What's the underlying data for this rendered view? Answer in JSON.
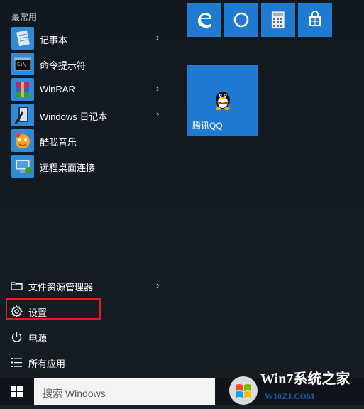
{
  "start_menu": {
    "section_title": "最常用",
    "apps": [
      {
        "label": "记事本",
        "icon": "notepad-icon",
        "has_submenu": true
      },
      {
        "label": "命令提示符",
        "icon": "cmd-icon",
        "has_submenu": false
      },
      {
        "label": "WinRAR",
        "icon": "winrar-icon",
        "has_submenu": true
      },
      {
        "label": "Windows 日记本",
        "icon": "journal-icon",
        "has_submenu": true
      },
      {
        "label": "酷我音乐",
        "icon": "kuwo-music-icon",
        "has_submenu": false
      },
      {
        "label": "远程桌面连接",
        "icon": "remote-desktop-icon",
        "has_submenu": false
      }
    ],
    "system_items": [
      {
        "label": "文件资源管理器",
        "icon": "folder-icon",
        "has_submenu": true
      },
      {
        "label": "设置",
        "icon": "gear-icon",
        "highlighted": true
      },
      {
        "label": "电源",
        "icon": "power-icon"
      },
      {
        "label": "所有应用",
        "icon": "list-icon"
      }
    ],
    "tiles": [
      {
        "name": "edge",
        "icon": "edge-icon"
      },
      {
        "name": "cortana",
        "icon": "cortana-circle-icon"
      },
      {
        "name": "calculator",
        "icon": "calculator-icon"
      },
      {
        "name": "store",
        "icon": "store-bag-icon"
      }
    ],
    "qq_tile": {
      "label": "腾讯QQ",
      "icon": "qq-penguin-icon"
    }
  },
  "taskbar": {
    "search_placeholder": "搜索 Windows",
    "start_icon": "windows-logo-icon"
  },
  "watermark": {
    "brand_text": "Win7系统之家",
    "url_text": "W10ZJ.COM"
  },
  "colors": {
    "tile_blue": "#1f7ad1",
    "highlight_red": "#e81b1b",
    "menu_bg": "#141a22"
  }
}
